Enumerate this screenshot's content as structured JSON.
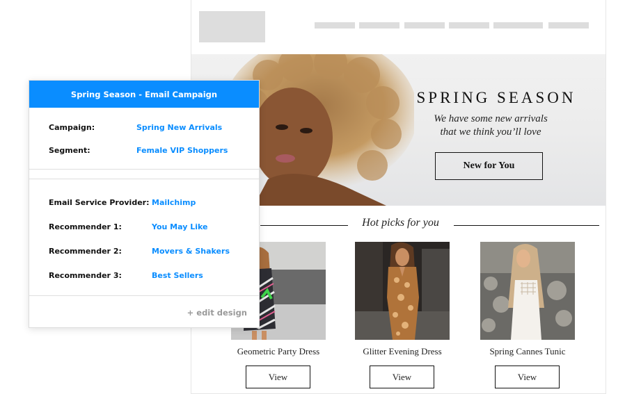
{
  "email": {
    "nav_items": [
      "",
      "",
      "",
      "",
      "",
      ""
    ],
    "hero": {
      "title": "SPRING SEASON",
      "subtitle_line1": "We have some new arrivals",
      "subtitle_line2": "that we think you’ll love",
      "cta_label": "New for You"
    },
    "section_title": "Hot picks for you",
    "products": [
      {
        "name": "Geometric Party Dress",
        "button": "View"
      },
      {
        "name": "Glitter Evening Dress",
        "button": "View"
      },
      {
        "name": "Spring Cannes Tunic",
        "button": "View"
      }
    ]
  },
  "panel": {
    "title": "Spring Season - Email Campaign",
    "campaign_label": "Campaign:",
    "campaign_value": "Spring New Arrivals",
    "segment_label": "Segment:",
    "segment_value": "Female VIP Shoppers",
    "esp_label": "Email Service Provider:",
    "esp_value": "Mailchimp",
    "recommenders": [
      {
        "label": "Recommender 1:",
        "value": "You May Like"
      },
      {
        "label": "Recommender 2:",
        "value": "Movers & Shakers"
      },
      {
        "label": "Recommender 3:",
        "value": "Best Sellers"
      }
    ],
    "edit_link": "+ edit design"
  },
  "colors": {
    "accent": "#0a8dff",
    "placeholder_gray": "#dddddd",
    "muted_text": "#9a9a9a"
  }
}
